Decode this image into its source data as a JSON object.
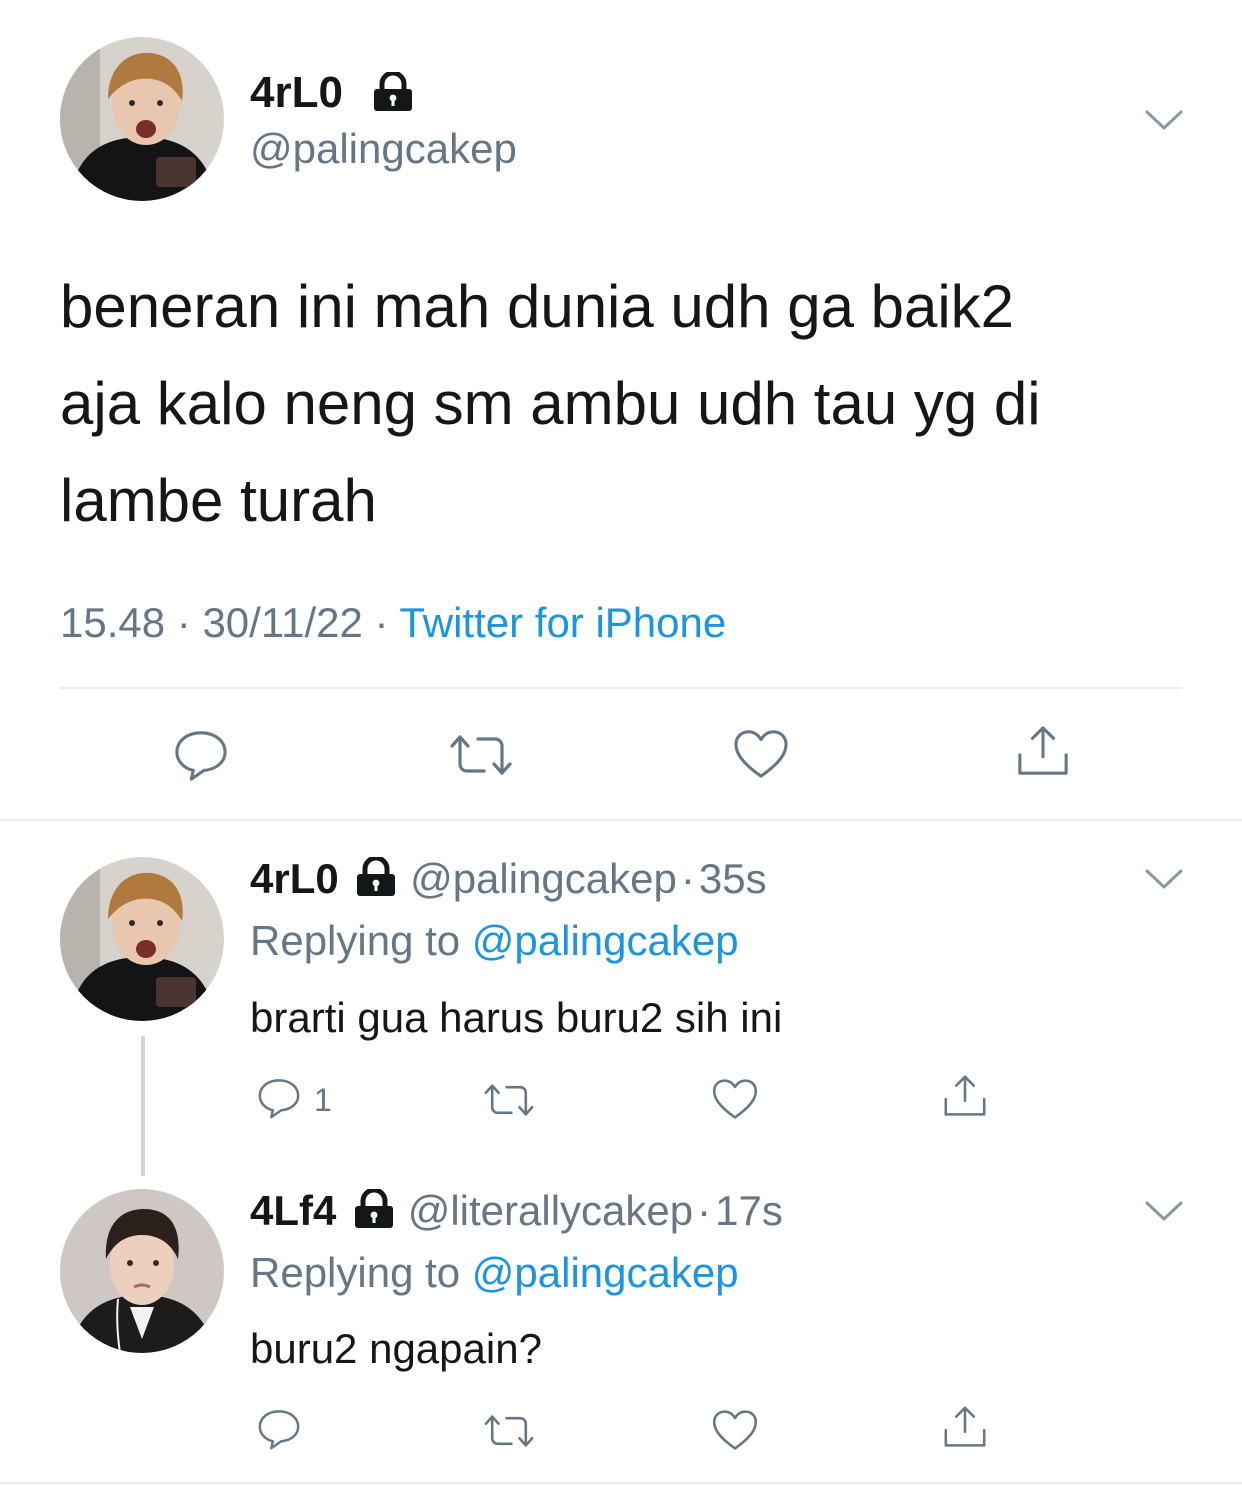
{
  "main_tweet": {
    "display_name": "4rL0",
    "handle": "@palingcakep",
    "text_lines": [
      "beneran ini mah dunia udh ga baik2",
      "aja kalo neng sm ambu udh tau yg di",
      "lambe turah"
    ],
    "time": "15.48",
    "separator": "·",
    "date": "30/11/22",
    "source": "Twitter for iPhone",
    "actions": [
      "reply-icon",
      "retweet-icon",
      "like-icon",
      "share-icon"
    ]
  },
  "replies": [
    {
      "display_name": "4rL0",
      "handle": "@palingcakep",
      "dot": "·",
      "age": "35s",
      "replying_prefix": "Replying to",
      "replying_to": "@palingcakep",
      "text": "brarti gua harus buru2 sih ini",
      "reply_count": "1"
    },
    {
      "display_name": "4Lf4",
      "handle": "@literallycakep",
      "dot": "·",
      "age": "17s",
      "replying_prefix": "Replying to",
      "replying_to": "@palingcakep",
      "text": "buru2 ngapain?",
      "reply_count": ""
    }
  ],
  "colors": {
    "text": "#14171a",
    "secondary": "#657786",
    "link": "#1b95e0",
    "divider": "#e6ecf0"
  }
}
